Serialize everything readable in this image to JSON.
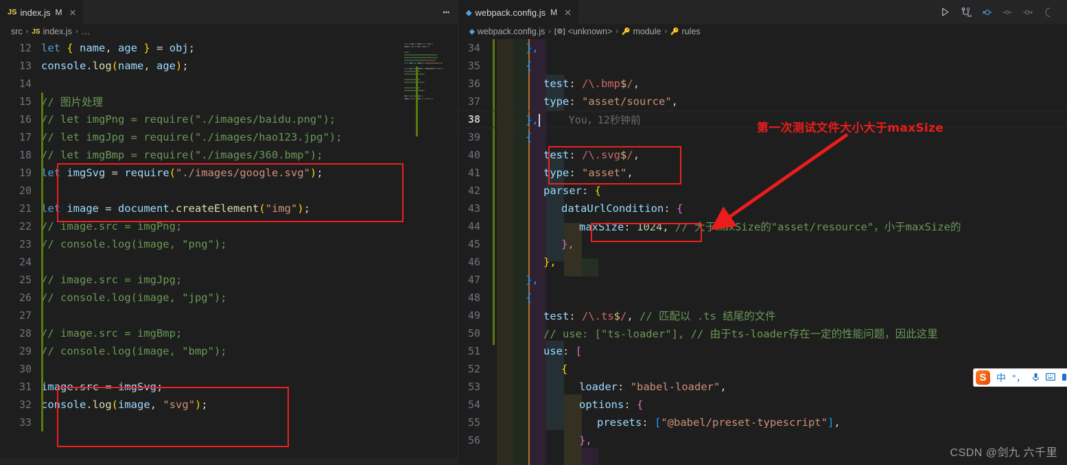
{
  "window": {
    "theme_bg": "#1e1e1e",
    "tabbar_bg": "#252526",
    "accent_red": "#ec1c1c",
    "gitbar_green": "#587c0c"
  },
  "left_group": {
    "tab": {
      "icon": "js-file-icon",
      "icon_label": "JS",
      "name": "index.js",
      "modified_badge": "M",
      "close_label": "✕"
    },
    "tabbar_more_label": "⋯",
    "breadcrumbs": [
      {
        "label": "src",
        "icon": ""
      },
      {
        "label": "index.js",
        "icon": "JS"
      },
      {
        "label": "…",
        "icon": ""
      }
    ],
    "breadcrumb_separator": "›",
    "lines": [
      {
        "n": "12",
        "tokens": [
          {
            "t": "let",
            "c": "t-kw"
          },
          {
            "t": " ",
            "c": "t-plain"
          },
          {
            "t": "{",
            "c": "t-b1"
          },
          {
            "t": " name",
            "c": "t-var"
          },
          {
            "t": ",",
            "c": "t-plain"
          },
          {
            "t": " age ",
            "c": "t-var"
          },
          {
            "t": "}",
            "c": "t-b1"
          },
          {
            "t": " ",
            "c": "t-plain"
          },
          {
            "t": "=",
            "c": "t-plain"
          },
          {
            "t": " obj",
            "c": "t-var"
          },
          {
            "t": ";",
            "c": "t-plain"
          }
        ]
      },
      {
        "n": "13",
        "tokens": [
          {
            "t": "console",
            "c": "t-var"
          },
          {
            "t": ".",
            "c": "t-plain"
          },
          {
            "t": "log",
            "c": "t-fn"
          },
          {
            "t": "(",
            "c": "t-b1"
          },
          {
            "t": "name",
            "c": "t-var"
          },
          {
            "t": ",",
            "c": "t-plain"
          },
          {
            "t": " age",
            "c": "t-var"
          },
          {
            "t": ")",
            "c": "t-b1"
          },
          {
            "t": ";",
            "c": "t-plain"
          }
        ]
      },
      {
        "n": "14",
        "tokens": []
      },
      {
        "n": "15",
        "tokens": [
          {
            "t": "// 图片处理",
            "c": "t-com"
          }
        ]
      },
      {
        "n": "16",
        "tokens": [
          {
            "t": "// let imgPng = require(\"./images/baidu.png\");",
            "c": "t-com"
          }
        ]
      },
      {
        "n": "17",
        "tokens": [
          {
            "t": "// let imgJpg = require(\"./images/hao123.jpg\");",
            "c": "t-com"
          }
        ]
      },
      {
        "n": "18",
        "tokens": [
          {
            "t": "// let imgBmp = require(\"./images/360.bmp\");",
            "c": "t-com"
          }
        ]
      },
      {
        "n": "19",
        "tokens": [
          {
            "t": "let",
            "c": "t-kw"
          },
          {
            "t": " ",
            "c": "t-plain"
          },
          {
            "t": "imgSvg",
            "c": "t-var"
          },
          {
            "t": " = ",
            "c": "t-plain"
          },
          {
            "t": "require",
            "c": "t-var"
          },
          {
            "t": "(",
            "c": "t-b1"
          },
          {
            "t": "\"./images/google.svg\"",
            "c": "t-str"
          },
          {
            "t": ")",
            "c": "t-b1"
          },
          {
            "t": ";",
            "c": "t-plain"
          }
        ]
      },
      {
        "n": "20",
        "tokens": []
      },
      {
        "n": "21",
        "tokens": [
          {
            "t": "let",
            "c": "t-kw"
          },
          {
            "t": " ",
            "c": "t-plain"
          },
          {
            "t": "image",
            "c": "t-var"
          },
          {
            "t": " = ",
            "c": "t-plain"
          },
          {
            "t": "document",
            "c": "t-var"
          },
          {
            "t": ".",
            "c": "t-plain"
          },
          {
            "t": "createElement",
            "c": "t-fn"
          },
          {
            "t": "(",
            "c": "t-b1"
          },
          {
            "t": "\"img\"",
            "c": "t-str"
          },
          {
            "t": ")",
            "c": "t-b1"
          },
          {
            "t": ";",
            "c": "t-plain"
          }
        ]
      },
      {
        "n": "22",
        "tokens": [
          {
            "t": "// image.src = imgPng;",
            "c": "t-com"
          }
        ]
      },
      {
        "n": "23",
        "tokens": [
          {
            "t": "// console.log(image, \"png\");",
            "c": "t-com"
          }
        ]
      },
      {
        "n": "24",
        "tokens": []
      },
      {
        "n": "25",
        "tokens": [
          {
            "t": "// image.src = imgJpg;",
            "c": "t-com"
          }
        ]
      },
      {
        "n": "26",
        "tokens": [
          {
            "t": "// console.log(image, \"jpg\");",
            "c": "t-com"
          }
        ]
      },
      {
        "n": "27",
        "tokens": []
      },
      {
        "n": "28",
        "tokens": [
          {
            "t": "// image.src = imgBmp;",
            "c": "t-com"
          }
        ]
      },
      {
        "n": "29",
        "tokens": [
          {
            "t": "// console.log(image, \"bmp\");",
            "c": "t-com"
          }
        ]
      },
      {
        "n": "30",
        "tokens": []
      },
      {
        "n": "31",
        "tokens": [
          {
            "t": "image",
            "c": "t-var"
          },
          {
            "t": ".",
            "c": "t-plain"
          },
          {
            "t": "src",
            "c": "t-var"
          },
          {
            "t": " = ",
            "c": "t-plain"
          },
          {
            "t": "imgSvg",
            "c": "t-var"
          },
          {
            "t": ";",
            "c": "t-plain"
          }
        ]
      },
      {
        "n": "32",
        "tokens": [
          {
            "t": "console",
            "c": "t-var"
          },
          {
            "t": ".",
            "c": "t-plain"
          },
          {
            "t": "log",
            "c": "t-fn"
          },
          {
            "t": "(",
            "c": "t-b1"
          },
          {
            "t": "image",
            "c": "t-var"
          },
          {
            "t": ",",
            "c": "t-plain"
          },
          {
            "t": " ",
            "c": "t-plain"
          },
          {
            "t": "\"svg\"",
            "c": "t-str"
          },
          {
            "t": ")",
            "c": "t-b1"
          },
          {
            "t": ";",
            "c": "t-plain"
          }
        ]
      },
      {
        "n": "33",
        "tokens": []
      }
    ]
  },
  "right_group": {
    "tab": {
      "icon": "webpack-file-icon",
      "name": "webpack.config.js",
      "modified_badge": "M",
      "close_label": "✕"
    },
    "actions": [
      {
        "name": "run-button",
        "glyph": "run"
      },
      {
        "name": "run-and-debug-button",
        "glyph": "branch"
      },
      {
        "name": "step-back-button",
        "glyph": "stepback"
      },
      {
        "name": "step-over-button",
        "glyph": "stepover"
      },
      {
        "name": "step-into-button",
        "glyph": "stepinto"
      },
      {
        "name": "more-actions-button",
        "glyph": "dot"
      }
    ],
    "breadcrumbs": [
      {
        "label": "webpack.config.js",
        "icon": "wp"
      },
      {
        "label": "<unknown>",
        "icon": "sym"
      },
      {
        "label": "module",
        "icon": "key"
      },
      {
        "label": "rules",
        "icon": "key"
      }
    ],
    "breadcrumb_separator": "›",
    "inline_blame": "You，12秒钟前",
    "lines": [
      {
        "n": "34",
        "indent": 2,
        "tokens": [
          {
            "t": "},",
            "c": "t-b3"
          }
        ]
      },
      {
        "n": "35",
        "indent": 2,
        "tokens": [
          {
            "t": "{",
            "c": "t-b3"
          }
        ]
      },
      {
        "n": "36",
        "indent": 3,
        "tokens": [
          {
            "t": "test",
            "c": "t-prop"
          },
          {
            "t": ": ",
            "c": "t-plain"
          },
          {
            "t": "/\\.bmp",
            "c": "t-regex"
          },
          {
            "t": "$",
            "c": "t-regexesc"
          },
          {
            "t": "/",
            "c": "t-regex"
          },
          {
            "t": ",",
            "c": "t-plain"
          }
        ]
      },
      {
        "n": "37",
        "indent": 3,
        "tokens": [
          {
            "t": "type",
            "c": "t-prop"
          },
          {
            "t": ": ",
            "c": "t-plain"
          },
          {
            "t": "\"asset/source\"",
            "c": "t-str"
          },
          {
            "t": ",",
            "c": "t-plain"
          }
        ]
      },
      {
        "n": "38",
        "indent": 2,
        "current": true,
        "tokens": [
          {
            "t": "},",
            "c": "t-b3"
          }
        ]
      },
      {
        "n": "39",
        "indent": 2,
        "tokens": [
          {
            "t": "{",
            "c": "t-b3"
          }
        ]
      },
      {
        "n": "40",
        "indent": 3,
        "tokens": [
          {
            "t": "test",
            "c": "t-prop"
          },
          {
            "t": ": ",
            "c": "t-plain"
          },
          {
            "t": "/\\.svg",
            "c": "t-regex"
          },
          {
            "t": "$",
            "c": "t-regexesc"
          },
          {
            "t": "/",
            "c": "t-regex"
          },
          {
            "t": ",",
            "c": "t-plain"
          }
        ]
      },
      {
        "n": "41",
        "indent": 3,
        "tokens": [
          {
            "t": "type",
            "c": "t-prop"
          },
          {
            "t": ": ",
            "c": "t-plain"
          },
          {
            "t": "\"asset\"",
            "c": "t-str"
          },
          {
            "t": ",",
            "c": "t-plain"
          }
        ]
      },
      {
        "n": "42",
        "indent": 3,
        "tokens": [
          {
            "t": "parser",
            "c": "t-prop"
          },
          {
            "t": ": ",
            "c": "t-plain"
          },
          {
            "t": "{",
            "c": "t-b1"
          }
        ]
      },
      {
        "n": "43",
        "indent": 4,
        "tokens": [
          {
            "t": "dataUrlCondition",
            "c": "t-prop"
          },
          {
            "t": ": ",
            "c": "t-plain"
          },
          {
            "t": "{",
            "c": "t-b2"
          }
        ]
      },
      {
        "n": "44",
        "indent": 5,
        "tokens": [
          {
            "t": "maxSize",
            "c": "t-prop"
          },
          {
            "t": ": ",
            "c": "t-plain"
          },
          {
            "t": "1024",
            "c": "t-num"
          },
          {
            "t": ",",
            "c": "t-plain"
          },
          {
            "t": " // 大于maxSize的\"asset/resource\"，小于maxSize的",
            "c": "t-com"
          }
        ]
      },
      {
        "n": "45",
        "indent": 4,
        "tokens": [
          {
            "t": "},",
            "c": "t-b2"
          }
        ]
      },
      {
        "n": "46",
        "indent": 3,
        "tokens": [
          {
            "t": "},",
            "c": "t-b1"
          }
        ]
      },
      {
        "n": "47",
        "indent": 2,
        "tokens": [
          {
            "t": "},",
            "c": "t-b3"
          }
        ]
      },
      {
        "n": "48",
        "indent": 2,
        "tokens": [
          {
            "t": "{",
            "c": "t-b3"
          }
        ]
      },
      {
        "n": "49",
        "indent": 3,
        "tokens": [
          {
            "t": "test",
            "c": "t-prop"
          },
          {
            "t": ": ",
            "c": "t-plain"
          },
          {
            "t": "/\\.ts",
            "c": "t-regex"
          },
          {
            "t": "$",
            "c": "t-regexesc"
          },
          {
            "t": "/",
            "c": "t-regex"
          },
          {
            "t": ",",
            "c": "t-plain"
          },
          {
            "t": " // 匹配以 .ts 结尾的文件",
            "c": "t-com"
          }
        ]
      },
      {
        "n": "50",
        "indent": 3,
        "tokens": [
          {
            "t": "// use: [\"ts-loader\"], // 由于ts-loader存在一定的性能问题，因此这里",
            "c": "t-com"
          }
        ]
      },
      {
        "n": "51",
        "indent": 3,
        "tokens": [
          {
            "t": "use",
            "c": "t-prop"
          },
          {
            "t": ": ",
            "c": "t-plain"
          },
          {
            "t": "[",
            "c": "t-b2"
          }
        ]
      },
      {
        "n": "52",
        "indent": 4,
        "tokens": [
          {
            "t": "{",
            "c": "t-b1"
          }
        ]
      },
      {
        "n": "53",
        "indent": 5,
        "tokens": [
          {
            "t": "loader",
            "c": "t-prop"
          },
          {
            "t": ": ",
            "c": "t-plain"
          },
          {
            "t": "\"babel-loader\"",
            "c": "t-str"
          },
          {
            "t": ",",
            "c": "t-plain"
          }
        ]
      },
      {
        "n": "54",
        "indent": 5,
        "tokens": [
          {
            "t": "options",
            "c": "t-prop"
          },
          {
            "t": ": ",
            "c": "t-plain"
          },
          {
            "t": "{",
            "c": "t-b2"
          }
        ]
      },
      {
        "n": "55",
        "indent": 6,
        "tokens": [
          {
            "t": "presets",
            "c": "t-prop"
          },
          {
            "t": ": ",
            "c": "t-plain"
          },
          {
            "t": "[",
            "c": "t-b3"
          },
          {
            "t": "\"@babel/preset-typescript\"",
            "c": "t-str"
          },
          {
            "t": "]",
            "c": "t-b3"
          },
          {
            "t": ",",
            "c": "t-plain"
          }
        ]
      },
      {
        "n": "56",
        "indent": 5,
        "tokens": [
          {
            "t": "},",
            "c": "t-b2"
          }
        ]
      }
    ]
  },
  "annotations": {
    "callout_text": "第一次测试文件大小大于maxSize",
    "callout_color": "#ec1c1c",
    "boxes": [
      {
        "name": "highlight-box-imgsvg"
      },
      {
        "name": "highlight-box-image-src"
      },
      {
        "name": "highlight-box-svg-asset"
      },
      {
        "name": "highlight-box-maxsize"
      }
    ]
  },
  "ime": {
    "logo_label": "S",
    "items": [
      {
        "name": "ime-mode-chinese",
        "label": "中"
      },
      {
        "name": "ime-punctuation",
        "label": "°，"
      },
      {
        "name": "ime-voice-input",
        "label": "🎙"
      },
      {
        "name": "ime-soft-keyboard",
        "label": "⌨"
      },
      {
        "name": "ime-toolbox",
        "label": "▮"
      }
    ]
  },
  "watermark": {
    "text": "CSDN @剑九 六千里"
  }
}
